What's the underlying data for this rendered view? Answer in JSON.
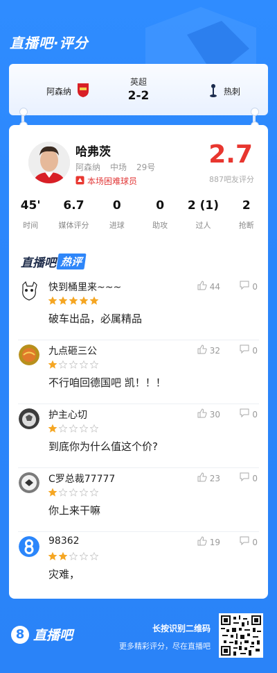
{
  "header": {
    "title": "直播吧·评分"
  },
  "match": {
    "home_team": "阿森纳",
    "away_team": "热刺",
    "league": "英超",
    "score": "2-2"
  },
  "player": {
    "name": "哈弗茨",
    "team": "阿森纳",
    "position": "中场",
    "number": "29号",
    "badge": "本场困难球员",
    "rating": "2.7",
    "rating_count": "887吧友评分"
  },
  "stats": [
    {
      "value": "45'",
      "label": "时间"
    },
    {
      "value": "6.7",
      "label": "媒体评分"
    },
    {
      "value": "0",
      "label": "进球"
    },
    {
      "value": "0",
      "label": "助攻"
    },
    {
      "value": "2 (1)",
      "label": "过人"
    },
    {
      "value": "2",
      "label": "抢断"
    }
  ],
  "hot_comments": {
    "title_a": "直播吧",
    "title_b": "热评",
    "items": [
      {
        "user": "快到桶里来~~~",
        "stars": 5,
        "text": "破车出品，必属精品",
        "likes": "44",
        "dislikes": "0"
      },
      {
        "user": "九点砸三公",
        "stars": 1,
        "text": "不行咱回德国吧 凯！！！",
        "likes": "32",
        "dislikes": "0"
      },
      {
        "user": "护主心切",
        "stars": 1,
        "text": "到底你为什么值这个价?",
        "likes": "30",
        "dislikes": "0"
      },
      {
        "user": "C罗总裁77777",
        "stars": 1,
        "text": "你上来干嘛",
        "likes": "23",
        "dislikes": "0"
      },
      {
        "user": "98362",
        "stars": 2,
        "text": "灾难，",
        "likes": "19",
        "dislikes": "0"
      }
    ]
  },
  "footer": {
    "brand": "直播吧",
    "qr_title": "长按识别二维码",
    "qr_sub": "更多精彩评分，尽在直播吧"
  },
  "colors": {
    "brand_blue": "#2b86fb",
    "rating_red": "#e8362f",
    "star_gold": "#f5a623"
  }
}
